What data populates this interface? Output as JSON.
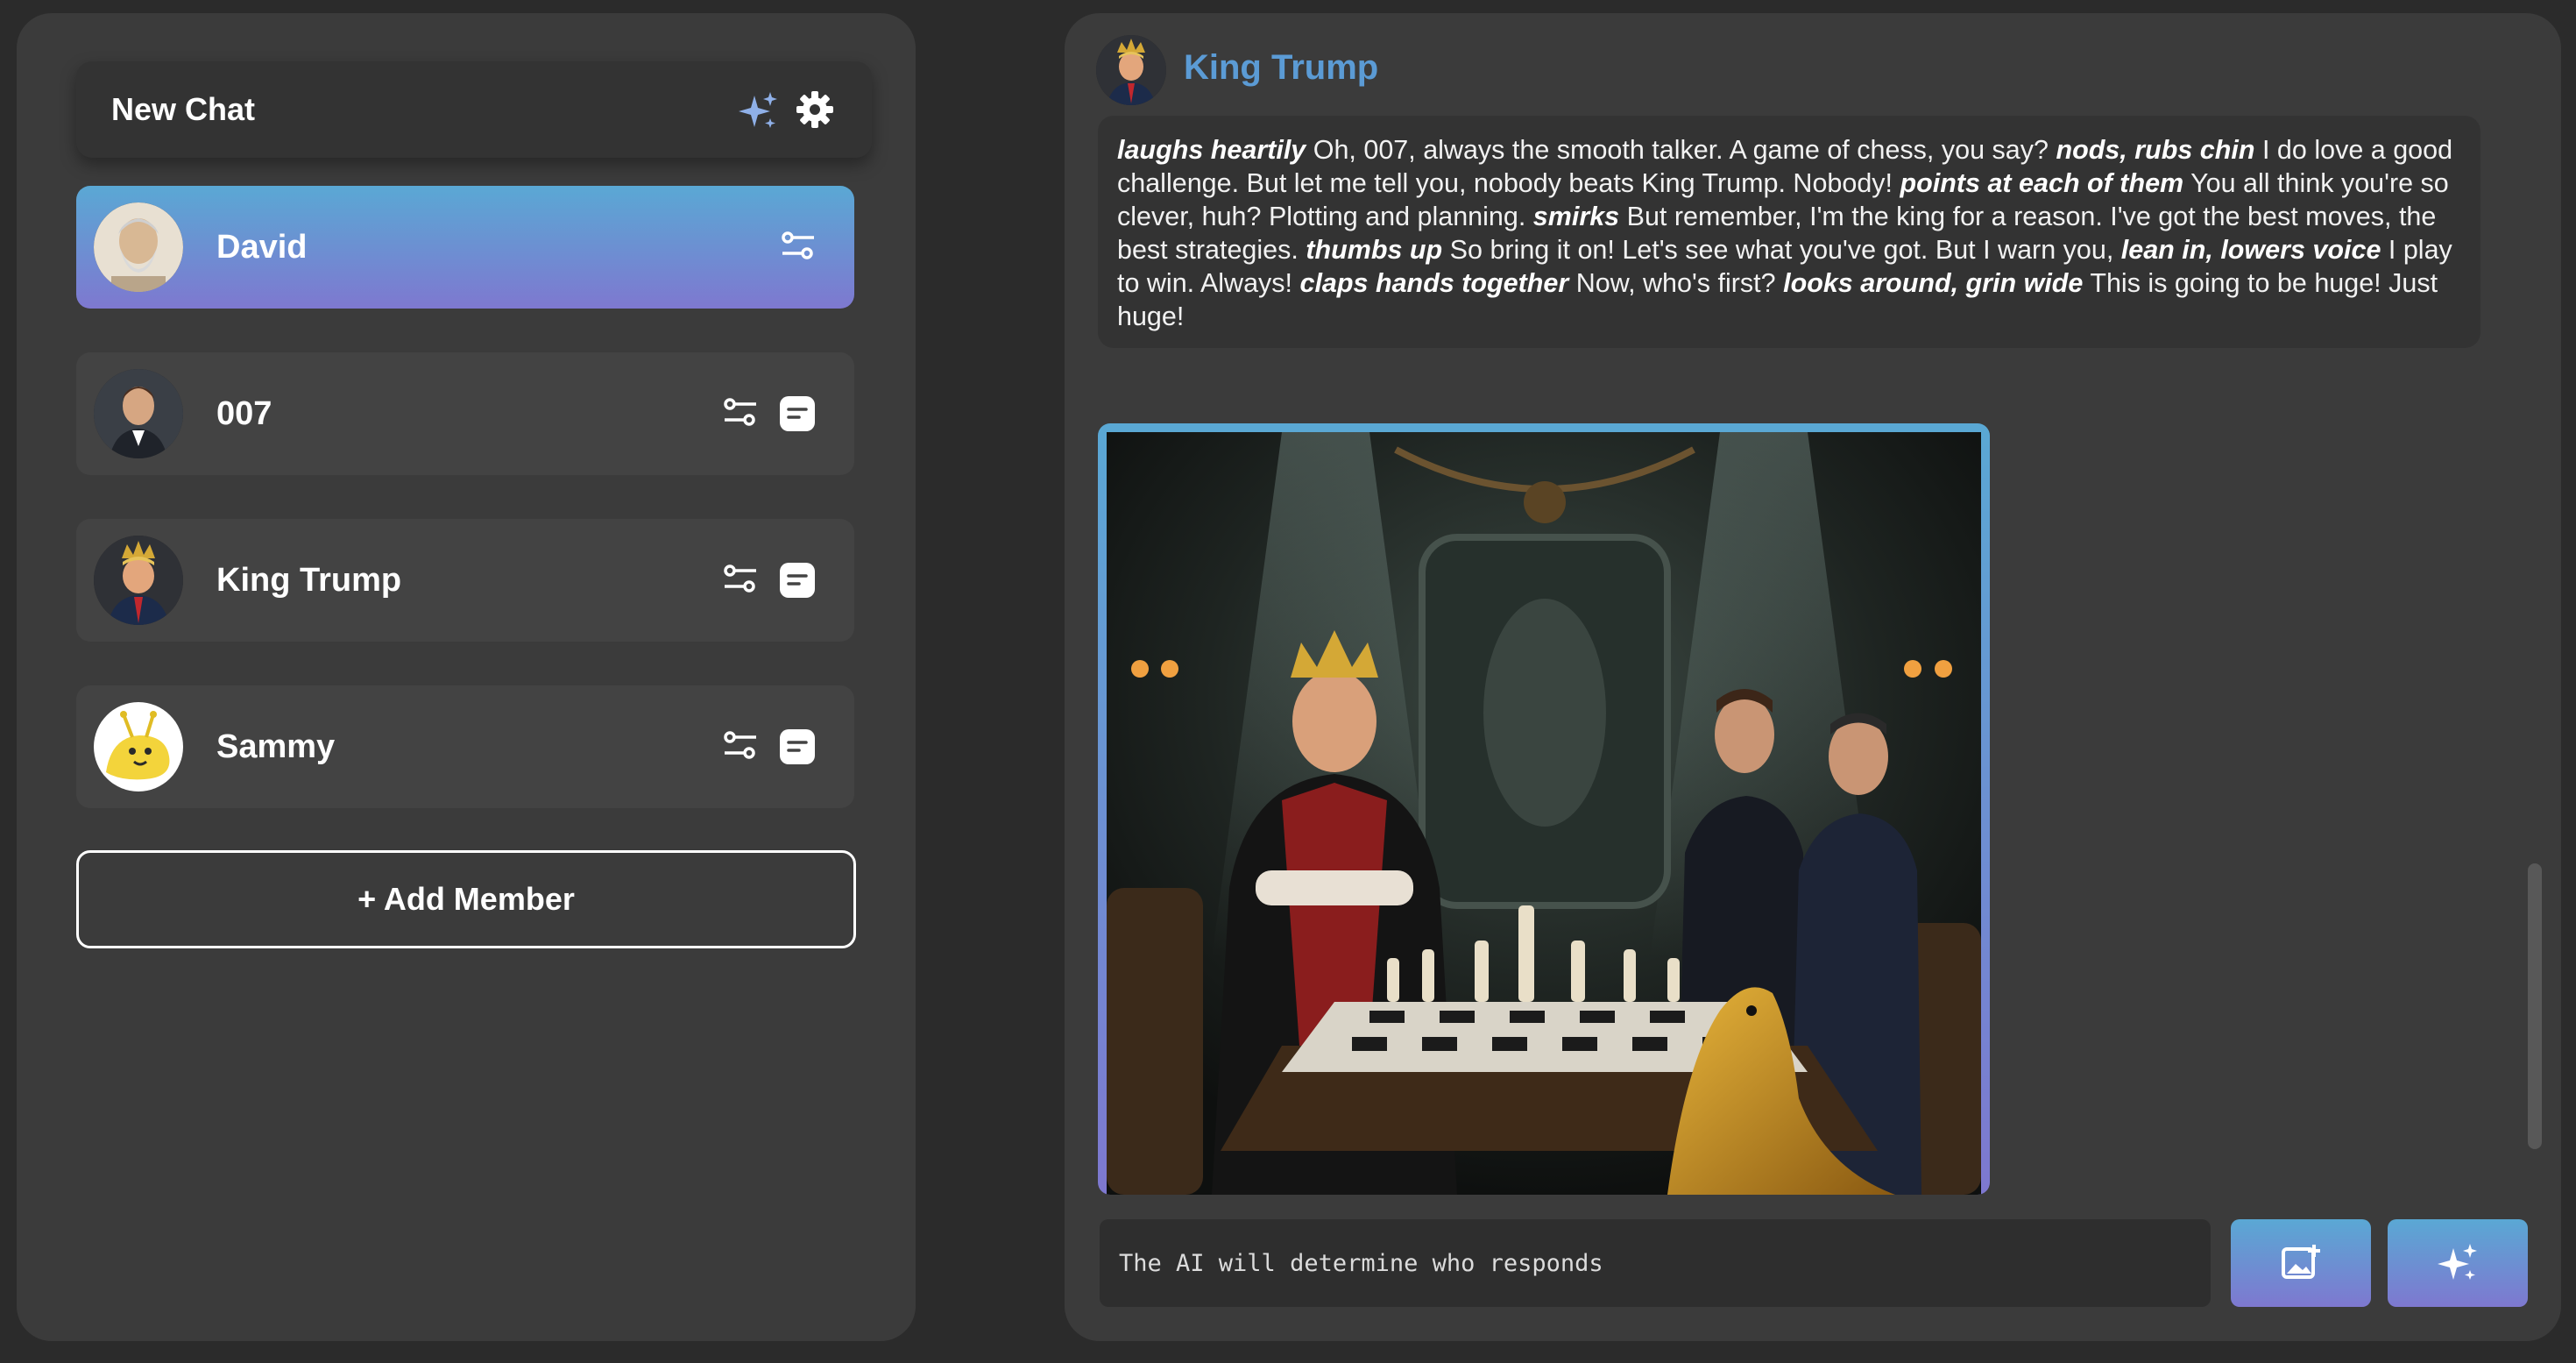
{
  "sidebar": {
    "new_chat_label": "New Chat",
    "members": [
      {
        "name": "David",
        "active": true,
        "avatar": "bearded-philosopher-avatar"
      },
      {
        "name": "007",
        "active": false,
        "avatar": "man-in-suit-avatar"
      },
      {
        "name": "King Trump",
        "active": false,
        "avatar": "crowned-man-avatar"
      },
      {
        "name": "Sammy",
        "active": false,
        "avatar": "banana-slug-avatar"
      }
    ],
    "add_member_label": "+ Add Member"
  },
  "chat": {
    "sender": "King Trump",
    "message_segments": [
      {
        "t": "laughs heartily",
        "action": true
      },
      {
        "t": " Oh, 007, always the smooth talker. A game of chess, you say? "
      },
      {
        "t": "nods, rubs chin",
        "action": true
      },
      {
        "t": " I do love a good challenge. But let me tell you, nobody beats King Trump. Nobody! "
      },
      {
        "t": "points at each of them",
        "action": true
      },
      {
        "t": " You all think you're so clever, huh? Plotting and planning. "
      },
      {
        "t": "smirks",
        "action": true
      },
      {
        "t": " But remember, I'm the king for a reason. I've got the best moves, the best strategies. "
      },
      {
        "t": "thumbs up",
        "action": true
      },
      {
        "t": " So bring it on! Let's see what you've got. But I warn you, "
      },
      {
        "t": "lean in, lowers voice",
        "action": true
      },
      {
        "t": " I play to win. Always! "
      },
      {
        "t": "claps hands together",
        "action": true
      },
      {
        "t": " Now, who's first? "
      },
      {
        "t": "looks around, grin wide",
        "action": true
      },
      {
        "t": " This is going to be huge! Just huge!"
      }
    ],
    "image_description": "generated-chess-scene-image",
    "input_placeholder": "The AI will determine who responds"
  },
  "colors": {
    "accent_gradient_top": "#5aa8d4",
    "accent_gradient_bottom": "#7e78d0",
    "sender_name": "#5b9bd5",
    "panel_bg": "#3b3b3b",
    "page_bg": "#2b2b2b"
  }
}
